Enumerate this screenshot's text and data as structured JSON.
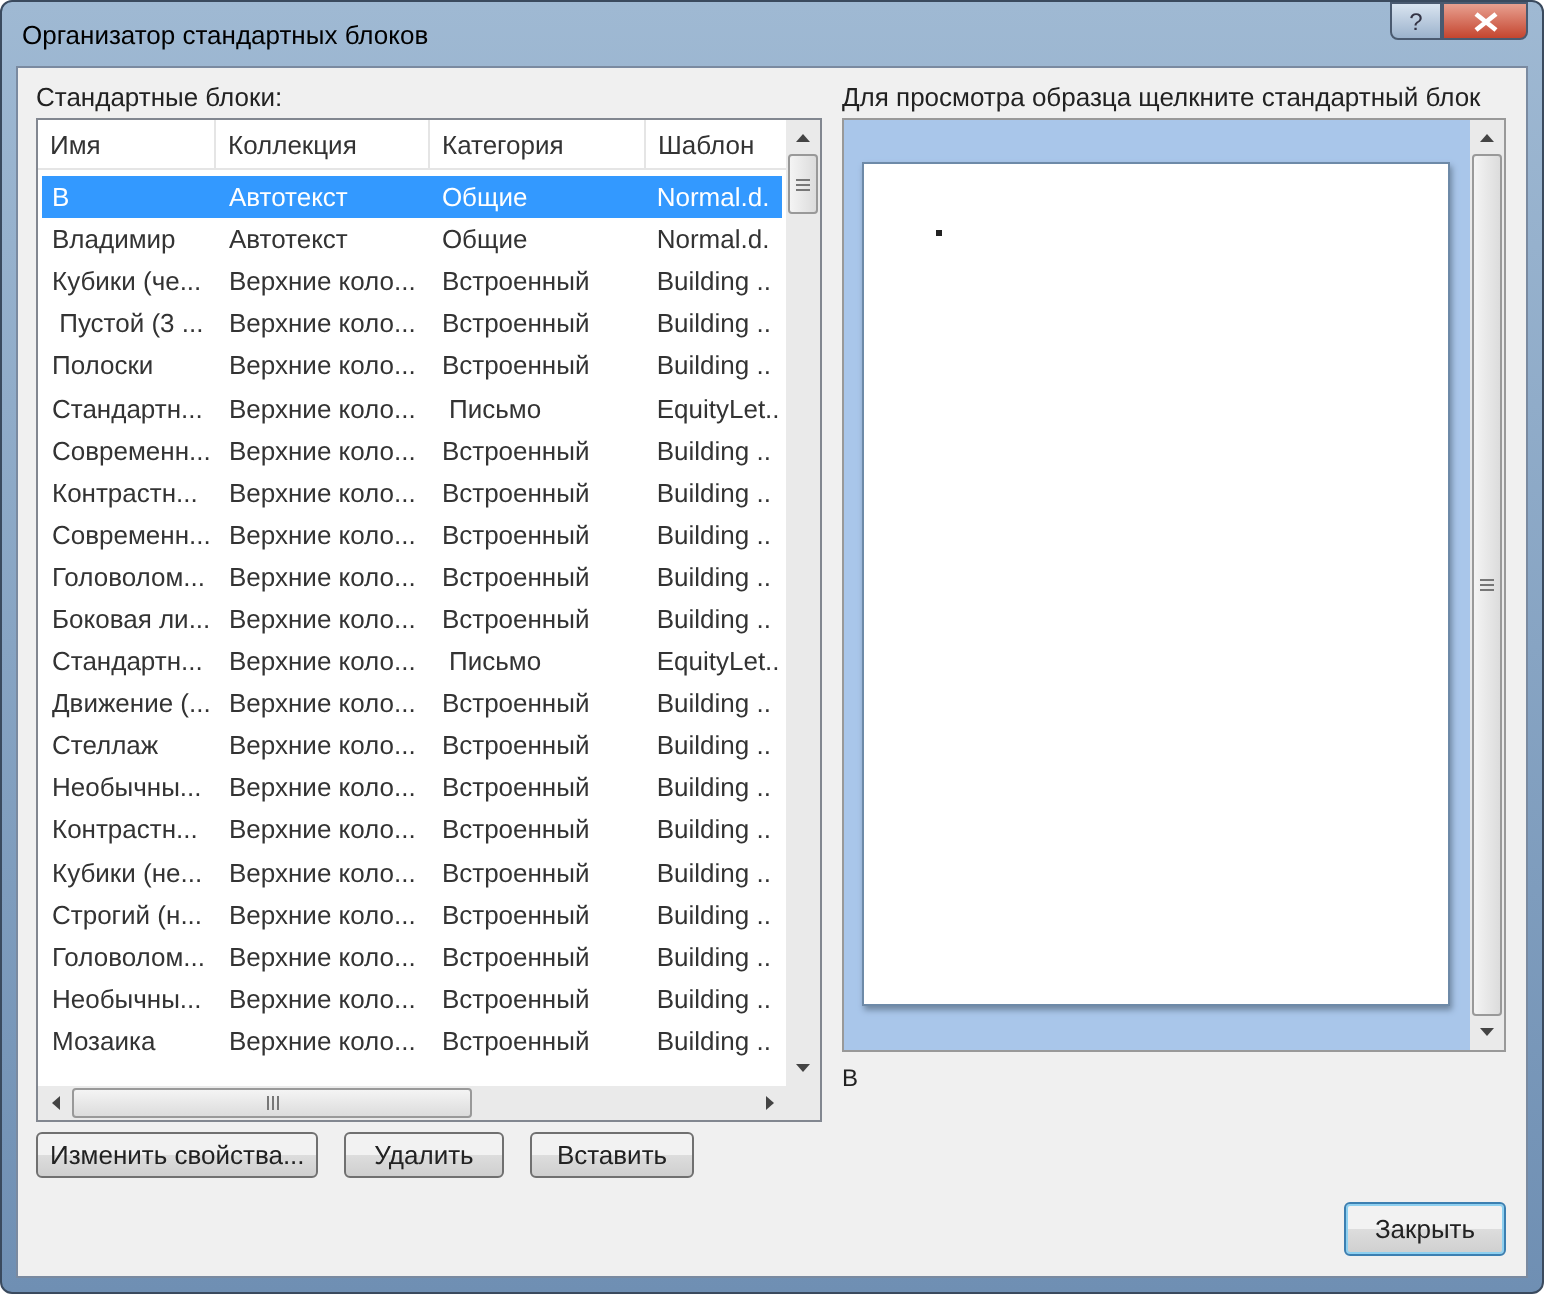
{
  "window": {
    "title": "Организатор стандартных блоков",
    "help_button": "?"
  },
  "blocks": {
    "label": "Стандартные блоки:",
    "columns": [
      "Имя",
      "Коллекция",
      "Категория",
      "Шаблон"
    ],
    "rows": [
      {
        "cells": [
          "В",
          "Автотекст",
          "Общие",
          "Normal.d."
        ],
        "selected": true
      },
      {
        "cells": [
          "Владимир",
          "Автотекст",
          "Общие",
          "Normal.d."
        ],
        "selected": false
      },
      {
        "cells": [
          "Кубики (че...",
          "Верхние коло...",
          "Встроенный",
          "Building .."
        ],
        "selected": false
      },
      {
        "cells": [
          " Пустой (3 ...",
          "Верхние коло...",
          "Встроенный",
          "Building .."
        ],
        "selected": false
      },
      {
        "cells": [
          "Полоски",
          "Верхние коло...",
          "Встроенный",
          "Building .."
        ],
        "selected": false
      },
      {
        "cells": [
          "Стандартн...",
          "Верхние коло...",
          " Письмо",
          "EquityLet.."
        ],
        "selected": false
      },
      {
        "cells": [
          "Современн...",
          "Верхние коло...",
          "Встроенный",
          "Building .."
        ],
        "selected": false
      },
      {
        "cells": [
          "Контрастн...",
          "Верхние коло...",
          "Встроенный",
          "Building .."
        ],
        "selected": false
      },
      {
        "cells": [
          "Современн...",
          "Верхние коло...",
          "Встроенный",
          "Building .."
        ],
        "selected": false
      },
      {
        "cells": [
          "Головолом...",
          "Верхние коло...",
          "Встроенный",
          "Building .."
        ],
        "selected": false
      },
      {
        "cells": [
          "Боковая ли...",
          "Верхние коло...",
          "Встроенный",
          "Building .."
        ],
        "selected": false
      },
      {
        "cells": [
          "Стандартн...",
          "Верхние коло...",
          " Письмо",
          "EquityLet.."
        ],
        "selected": false
      },
      {
        "cells": [
          "Движение (...",
          "Верхние коло...",
          "Встроенный",
          "Building .."
        ],
        "selected": false
      },
      {
        "cells": [
          "Стеллаж",
          "Верхние коло...",
          "Встроенный",
          "Building .."
        ],
        "selected": false
      },
      {
        "cells": [
          "Необычны...",
          "Верхние коло...",
          "Встроенный",
          "Building .."
        ],
        "selected": false
      },
      {
        "cells": [
          "Контрастн...",
          "Верхние коло...",
          "Встроенный",
          "Building .."
        ],
        "selected": false
      },
      {
        "cells": [
          "Кубики (не...",
          "Верхние коло...",
          "Встроенный",
          "Building .."
        ],
        "selected": false
      },
      {
        "cells": [
          "Строгий (н...",
          "Верхние коло...",
          "Встроенный",
          "Building .."
        ],
        "selected": false
      },
      {
        "cells": [
          "Головолом...",
          "Верхние коло...",
          "Встроенный",
          "Building .."
        ],
        "selected": false
      },
      {
        "cells": [
          "Необычны...",
          "Верхние коло...",
          "Встроенный",
          "Building .."
        ],
        "selected": false
      },
      {
        "cells": [
          "Мозаика",
          "Верхние коло...",
          "Встроенный",
          "Building .."
        ],
        "selected": false
      }
    ],
    "buttons": [
      "Изменить свойства...",
      "Удалить",
      "Вставить"
    ]
  },
  "preview": {
    "label": "Для просмотра образца щелкните стандартный блок",
    "caption": "В"
  },
  "close_button": "Закрыть"
}
